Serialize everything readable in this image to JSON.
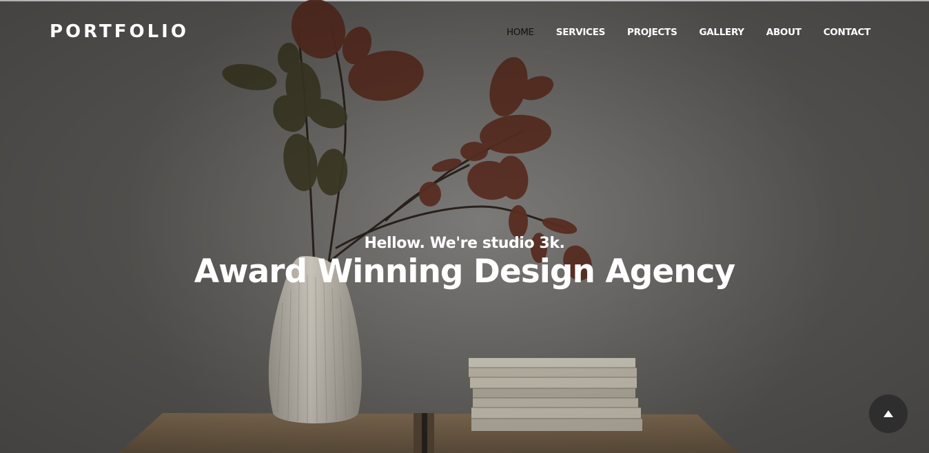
{
  "brand": {
    "name": "PORTFOLIO"
  },
  "nav": {
    "items": [
      {
        "label": "HOME",
        "active": true
      },
      {
        "label": "SERVICES",
        "active": false
      },
      {
        "label": "PROJECTS",
        "active": false
      },
      {
        "label": "GALLERY",
        "active": false
      },
      {
        "label": "ABOUT",
        "active": false
      },
      {
        "label": "CONTACT",
        "active": false
      }
    ]
  },
  "hero": {
    "subtitle": "Hellow. We're studio 3k.",
    "title": "Award Winning Design Agency",
    "background_image": "vase-with-branches-and-books-on-shelf"
  },
  "back_to_top": {
    "icon": "arrow-up-icon"
  },
  "colors": {
    "text_primary": "#ffffff",
    "nav_active": "#111111",
    "button_bg": "#2e2e2e"
  }
}
